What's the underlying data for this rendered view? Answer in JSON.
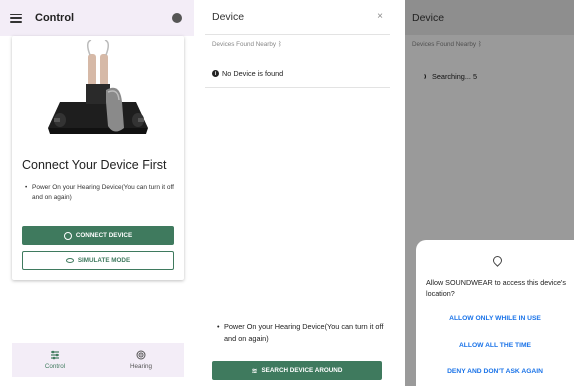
{
  "screen1": {
    "title": "Control",
    "heading": "Connect Your Device First",
    "bullet": "Power On your Hearing Device(You can turn it off and on again)",
    "connect_button": "CONNECT DEVICE",
    "simulate_button": "SIMULATE MODE",
    "nav": [
      {
        "label": "Control"
      },
      {
        "label": "Hearing"
      }
    ],
    "accent_color": "#3f7a5e"
  },
  "screen2": {
    "title": "Device",
    "close_symbol": "×",
    "subtitle": "Devices Found Nearby",
    "no_device": "No Device is found",
    "bullet": "Power On your Hearing Device(You can turn it off and on again)",
    "search_button": "SEARCH DEVICE AROUND"
  },
  "screen3": {
    "title": "Device",
    "subtitle": "Devices Found Nearby",
    "searching": "Searching... 5",
    "dialog": {
      "question": "Allow SOUNDWEAR to access this device's location?",
      "option1": "ALLOW ONLY WHILE IN USE",
      "option2": "ALLOW ALL THE TIME",
      "option3": "DENY AND DON'T ASK AGAIN"
    }
  }
}
